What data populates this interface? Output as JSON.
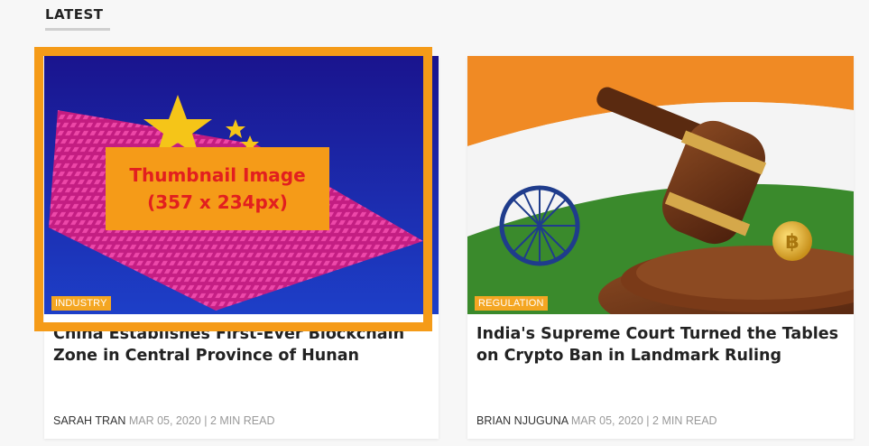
{
  "section": {
    "title": "LATEST"
  },
  "annotation": {
    "line1": "Thumbnail Image",
    "line2": "(357 x 234px)",
    "color": "#f59b18",
    "text_color": "#e21f1f"
  },
  "articles": [
    {
      "category": "INDUSTRY",
      "category_color": "#f4a622",
      "title": "China Establishes First-Ever Blockchain Zone in Central Province of Hunan",
      "author": "SARAH TRAN",
      "date": "MAR 05, 2020",
      "read_time": "2 MIN READ",
      "image": "china-blockchain-flag-illustration"
    },
    {
      "category": "REGULATION",
      "category_color": "#f4a622",
      "title": "India's Supreme Court Turned the Tables on Crypto Ban in Landmark Ruling",
      "author": "BRIAN NJUGUNA",
      "date": "MAR 05, 2020",
      "read_time": "2 MIN READ",
      "image": "india-flag-gavel-bitcoin-photo"
    }
  ]
}
